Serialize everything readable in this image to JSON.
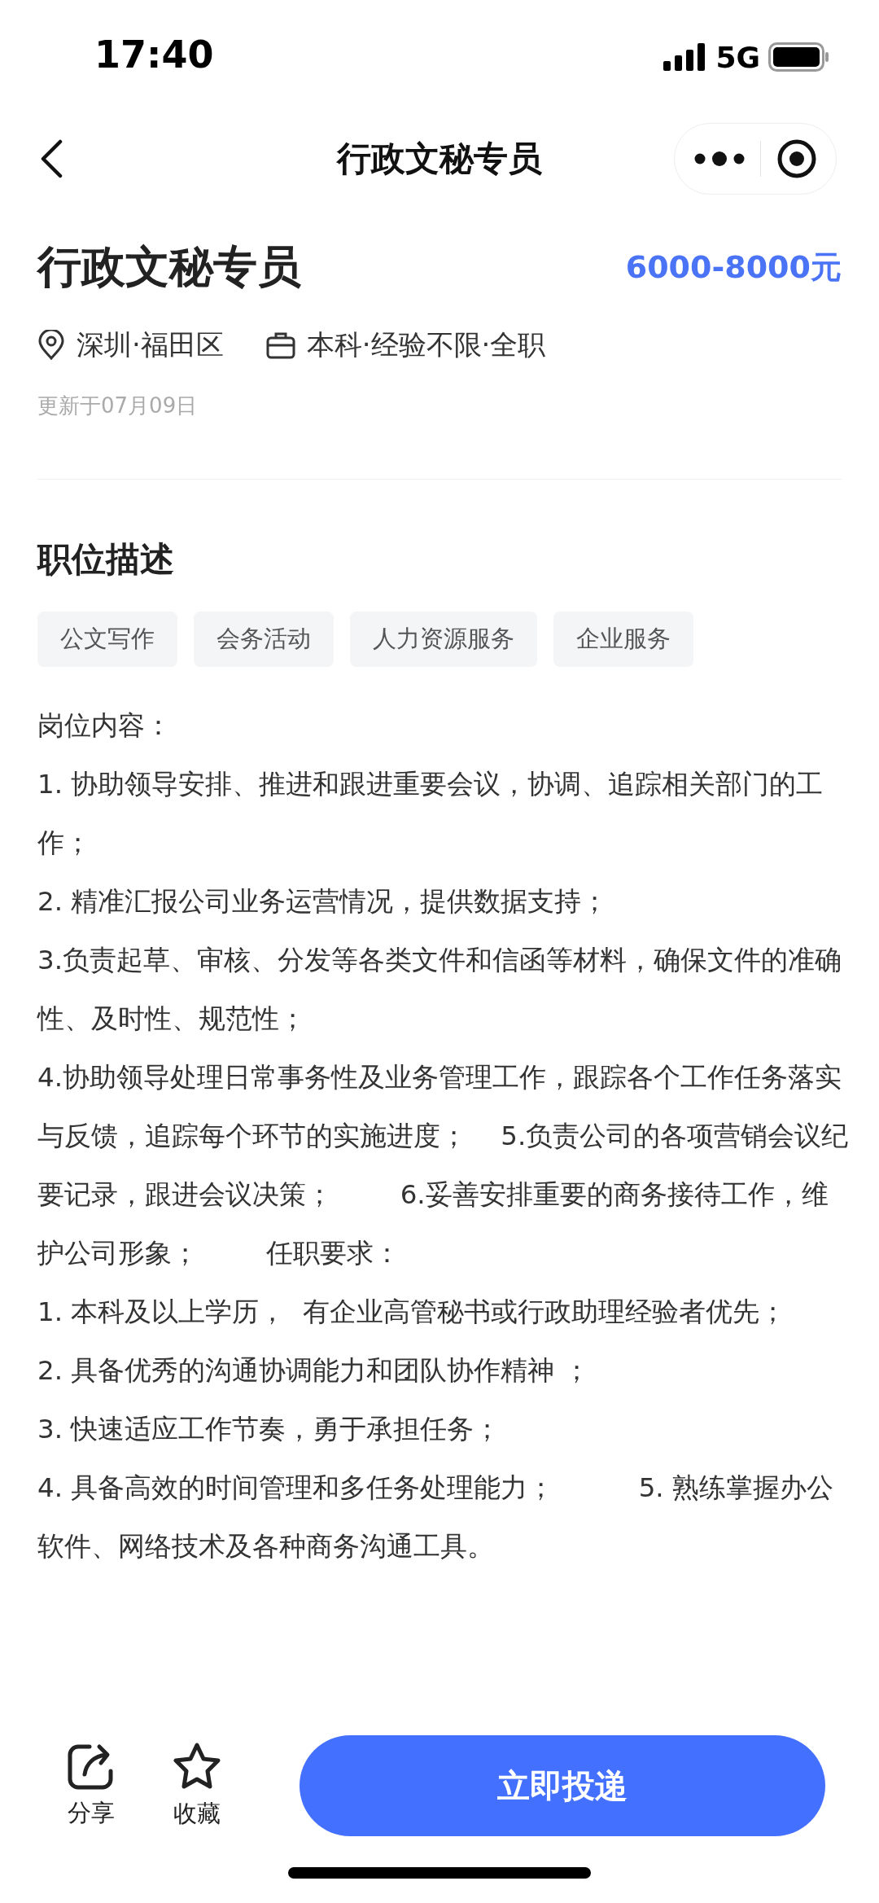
{
  "status_bar": {
    "time": "17:40",
    "network": "5G"
  },
  "nav": {
    "title": "行政文秘专员"
  },
  "job": {
    "title": "行政文秘专员",
    "salary": "6000-8000元",
    "location": "深圳·福田区",
    "requirements": "本科·经验不限·全职",
    "updated": "更新于07月09日"
  },
  "section": {
    "heading": "职位描述"
  },
  "tags": [
    "公文写作",
    "会务活动",
    "人力资源服务",
    "企业服务"
  ],
  "description": [
    "岗位内容：",
    "1. 协助领导安排、推进和跟进重要会议，协调、追踪相关部门的工作；",
    "2. 精准汇报公司业务运营情况，提供数据支持；",
    "3.负责起草、审核、分发等各类文件和信函等材料，确保文件的准确性、及时性、规范性；",
    "4.协助领导处理日常事务性及业务管理工作，跟踪各个工作任务落实与反馈，追踪每个环节的实施进度；    5.负责公司的各项营销会议纪要记录，跟进会议决策；        6.妥善安排重要的商务接待工作，维护公司形象；        任职要求：",
    "1. 本科及以上学历，  有企业高管秘书或行政助理经验者优先；",
    "2. 具备优秀的沟通协调能力和团队协作精神 ；",
    "3. 快速适应工作节奏，勇于承担任务；",
    "4. 具备高效的时间管理和多任务处理能力；          5. 熟练掌握办公软件、网络技术及各种商务沟通工具。"
  ],
  "bottom_bar": {
    "actions": [
      {
        "kind": "share",
        "label": "分享"
      },
      {
        "kind": "favorite",
        "label": "收藏"
      }
    ],
    "apply_button": "立即投递"
  }
}
